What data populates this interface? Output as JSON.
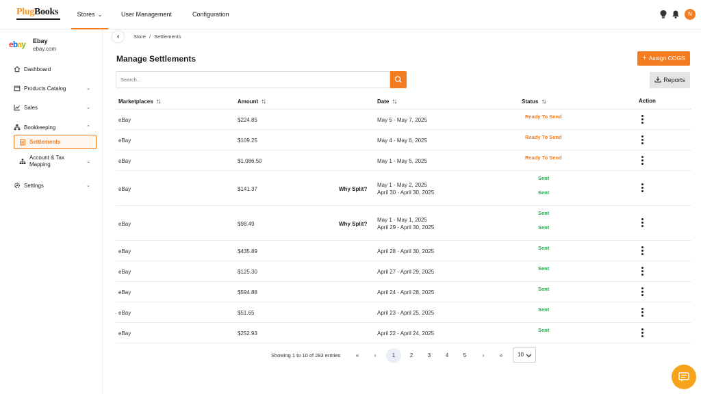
{
  "brand": {
    "logo_plug": "Plug",
    "logo_books": "Books"
  },
  "topnav": {
    "stores": "Stores",
    "user_management": "User Management",
    "configuration": "Configuration",
    "avatar_initial": "N"
  },
  "sidebar": {
    "store_name": "Ebay",
    "store_domain": "ebay.com",
    "items": [
      {
        "label": "Dashboard",
        "icon": "home-icon"
      },
      {
        "label": "Products Catalog",
        "icon": "box-icon"
      },
      {
        "label": "Sales",
        "icon": "chart-line-icon"
      },
      {
        "label": "Bookkeeping",
        "icon": "network-icon"
      },
      {
        "label": "Settlements",
        "icon": "document-icon"
      },
      {
        "label_line1": "Account & Tax",
        "label_line2": "Mapping",
        "icon": "sitemap-icon"
      },
      {
        "label": "Settings",
        "icon": "gear-icon"
      }
    ]
  },
  "breadcrumb": {
    "store": "Store",
    "separator": "/",
    "current": "Settlements"
  },
  "page": {
    "title": "Manage Settlements",
    "assign_cogs": "Assign COGS",
    "reports": "Reports",
    "search_placeholder": "Search..."
  },
  "table": {
    "headers": {
      "marketplaces": "Marketplaces",
      "amount": "Amount",
      "date": "Date",
      "status": "Status",
      "action": "Action"
    },
    "rows": [
      {
        "marketplace": "eBay",
        "amount": "$224.85",
        "why": "",
        "date1": "May 5 - May 7, 2025",
        "date2": "",
        "status1": "Ready To Send",
        "status2": ""
      },
      {
        "marketplace": "eBay",
        "amount": "$109.25",
        "why": "",
        "date1": "May 4 - May 6, 2025",
        "date2": "",
        "status1": "Ready To Send",
        "status2": ""
      },
      {
        "marketplace": "eBay",
        "amount": "$1,086.50",
        "why": "",
        "date1": "May 1 - May 5, 2025",
        "date2": "",
        "status1": "Ready To Send",
        "status2": ""
      },
      {
        "marketplace": "eBay",
        "amount": "$141.37",
        "why": "Why Split?",
        "date1": "May 1 - May 2, 2025",
        "date2": "April 30 - April 30, 2025",
        "status1": "Sent",
        "status2": "Sent"
      },
      {
        "marketplace": "eBay",
        "amount": "$98.49",
        "why": "Why Split?",
        "date1": "May 1 - May 1, 2025",
        "date2": "April 29 - April 30, 2025",
        "status1": "Sent",
        "status2": "Sent"
      },
      {
        "marketplace": "eBay",
        "amount": "$435.89",
        "why": "",
        "date1": "April 28 - April 30, 2025",
        "date2": "",
        "status1": "Sent",
        "status2": ""
      },
      {
        "marketplace": "eBay",
        "amount": "$125.30",
        "why": "",
        "date1": "April 27 - April 29, 2025",
        "date2": "",
        "status1": "Sent",
        "status2": ""
      },
      {
        "marketplace": "eBay",
        "amount": "$594.88",
        "why": "",
        "date1": "April 24 - April 28, 2025",
        "date2": "",
        "status1": "Sent",
        "status2": ""
      },
      {
        "marketplace": "eBay",
        "amount": "$51.65",
        "why": "",
        "date1": "April 23 - April 25, 2025",
        "date2": "",
        "status1": "Sent",
        "status2": ""
      },
      {
        "marketplace": "eBay",
        "amount": "$252.93",
        "why": "",
        "date1": "April 22 - April 24, 2025",
        "date2": "",
        "status1": "Sent",
        "status2": ""
      }
    ]
  },
  "pagination": {
    "info": "Showing 1 to 10 of 283 entries",
    "first": "«",
    "prev": "‹",
    "pages": [
      "1",
      "2",
      "3",
      "4",
      "5"
    ],
    "current_page": "1",
    "next": "›",
    "last": "»",
    "page_size": "10"
  },
  "colors": {
    "accent": "#f47c20",
    "sent": "#22a84a",
    "chat": "#f7a21b"
  }
}
